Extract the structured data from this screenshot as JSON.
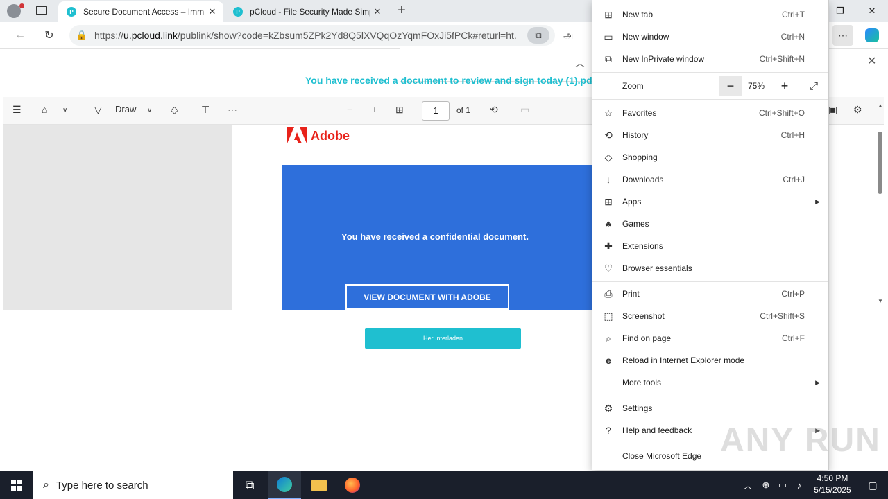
{
  "tabs": [
    {
      "title": "Secure Document Access – Imm",
      "active": true,
      "favicon": "pcloud-favicon"
    },
    {
      "title": "pCloud - File Security Made Simp",
      "active": false,
      "favicon": "pcloud-favicon"
    }
  ],
  "address": {
    "prefix": "https://",
    "host": "u.pcloud.link",
    "path": "/publink/show?code=kZbsum5ZPk2Yd8Q5lXVQqOzYqmFOxJi5fPCk#returl=ht..."
  },
  "pdf": {
    "document_title": "You have received a document to review and sign today (1).pdf",
    "toolbar": {
      "draw_label": "Draw",
      "page_current": "1",
      "page_total": "of 1"
    },
    "brand": "Adobe",
    "message": "You have received a confidential document.",
    "view_button": "VIEW DOCUMENT WITH ADOBE",
    "download_button": "Herunterladen"
  },
  "menu": {
    "items": [
      {
        "label": "New tab",
        "shortcut": "Ctrl+T",
        "icon": "new-tab-icon"
      },
      {
        "label": "New window",
        "shortcut": "Ctrl+N",
        "icon": "new-window-icon"
      },
      {
        "label": "New InPrivate window",
        "shortcut": "Ctrl+Shift+N",
        "icon": "inprivate-icon"
      },
      {
        "label": "Zoom",
        "shortcut": "",
        "icon": ""
      },
      {
        "label": "Favorites",
        "shortcut": "Ctrl+Shift+O",
        "icon": "star-icon"
      },
      {
        "label": "History",
        "shortcut": "Ctrl+H",
        "icon": "history-icon"
      },
      {
        "label": "Shopping",
        "shortcut": "",
        "icon": "tag-icon"
      },
      {
        "label": "Downloads",
        "shortcut": "Ctrl+J",
        "icon": "download-icon"
      },
      {
        "label": "Apps",
        "shortcut": "",
        "icon": "apps-icon"
      },
      {
        "label": "Games",
        "shortcut": "",
        "icon": "games-icon"
      },
      {
        "label": "Extensions",
        "shortcut": "",
        "icon": "puzzle-icon"
      },
      {
        "label": "Browser essentials",
        "shortcut": "",
        "icon": "heart-pulse-icon"
      },
      {
        "label": "Print",
        "shortcut": "Ctrl+P",
        "icon": "printer-icon"
      },
      {
        "label": "Screenshot",
        "shortcut": "Ctrl+Shift+S",
        "icon": "screenshot-icon"
      },
      {
        "label": "Find on page",
        "shortcut": "Ctrl+F",
        "icon": "find-icon"
      },
      {
        "label": "Reload in Internet Explorer mode",
        "shortcut": "",
        "icon": "ie-icon"
      },
      {
        "label": "More tools",
        "shortcut": "",
        "icon": ""
      },
      {
        "label": "Settings",
        "shortcut": "",
        "icon": "gear-icon"
      },
      {
        "label": "Help and feedback",
        "shortcut": "",
        "icon": "help-icon"
      },
      {
        "label": "Close Microsoft Edge",
        "shortcut": "",
        "icon": ""
      }
    ],
    "zoom_value": "75%"
  },
  "watermark": "ANY RUN",
  "taskbar": {
    "search_placeholder": "Type here to search",
    "time": "4:50 PM",
    "date": "5/15/2025"
  },
  "colors": {
    "accent_teal": "#1fbfd0",
    "adobe_red": "#e8231b",
    "doc_blue": "#2e6fdb"
  }
}
